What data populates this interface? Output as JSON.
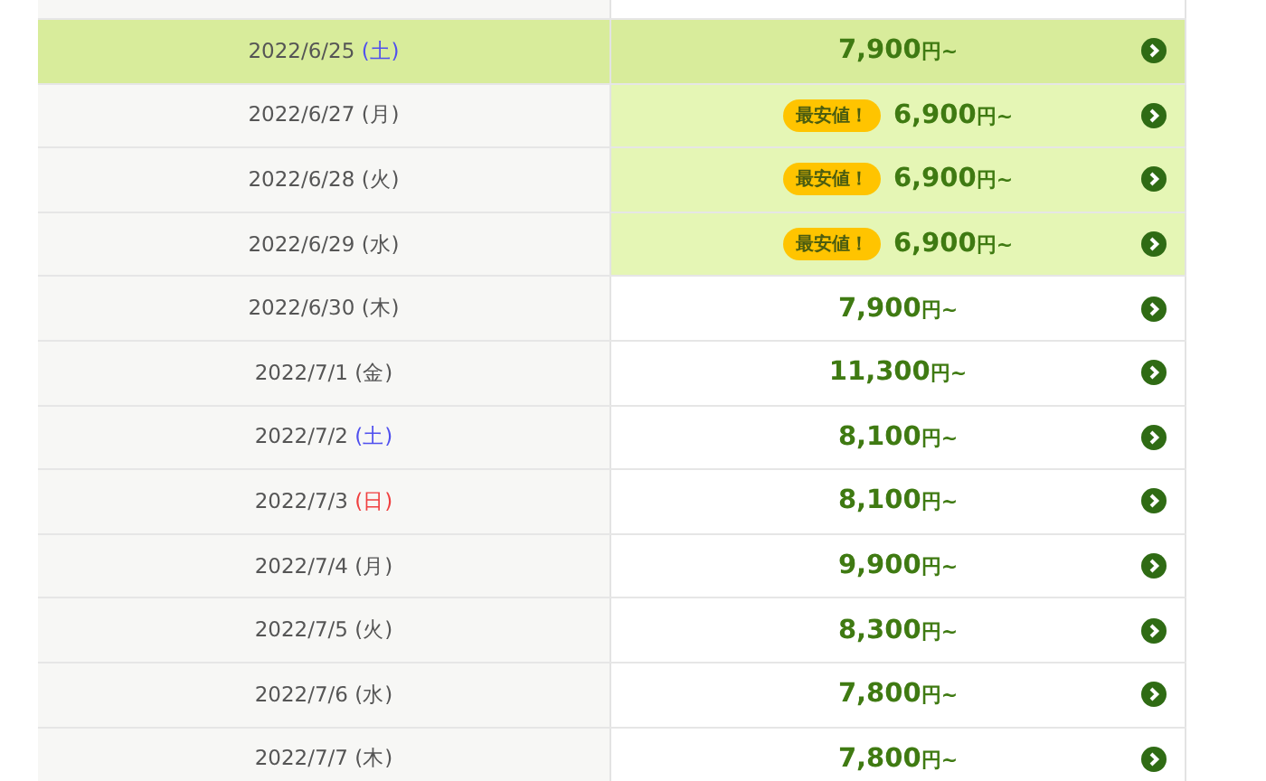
{
  "rows": [
    {
      "date": "2022/6/25",
      "weekday": "(土)",
      "color": "#5050ee",
      "price": "7,900",
      "unit": "円~",
      "selected": true
    },
    {
      "date": "2022/6/27",
      "weekday": "(月)",
      "color": "#555555",
      "price": "6,900",
      "unit": "円~",
      "selected": false,
      "badge": "最安値！"
    },
    {
      "date": "2022/6/28",
      "weekday": "(火)",
      "color": "#555555",
      "price": "6,900",
      "unit": "円~",
      "selected": false,
      "badge": "最安値！"
    },
    {
      "date": "2022/6/29",
      "weekday": "(水)",
      "color": "#555555",
      "price": "6,900",
      "unit": "円~",
      "selected": false,
      "badge": "最安値！"
    },
    {
      "date": "2022/6/30",
      "weekday": "(木)",
      "color": "#555555",
      "price": "7,900",
      "unit": "円~",
      "selected": false
    },
    {
      "date": "2022/7/1",
      "weekday": "(金)",
      "color": "#555555",
      "price": "11,300",
      "unit": "円~",
      "selected": false
    },
    {
      "date": "2022/7/2",
      "weekday": "(土)",
      "color": "#5050ee",
      "price": "8,100",
      "unit": "円~",
      "selected": false
    },
    {
      "date": "2022/7/3",
      "weekday": "(日)",
      "color": "#f04040",
      "price": "8,100",
      "unit": "円~",
      "selected": false
    },
    {
      "date": "2022/7/4",
      "weekday": "(月)",
      "color": "#555555",
      "price": "9,900",
      "unit": "円~",
      "selected": false
    },
    {
      "date": "2022/7/5",
      "weekday": "(火)",
      "color": "#555555",
      "price": "8,300",
      "unit": "円~",
      "selected": false
    },
    {
      "date": "2022/7/6",
      "weekday": "(水)",
      "color": "#555555",
      "price": "7,800",
      "unit": "円~",
      "selected": false
    },
    {
      "date": "2022/7/7",
      "weekday": "(木)",
      "color": "#555555",
      "price": "7,800",
      "unit": "円~",
      "selected": false
    }
  ]
}
